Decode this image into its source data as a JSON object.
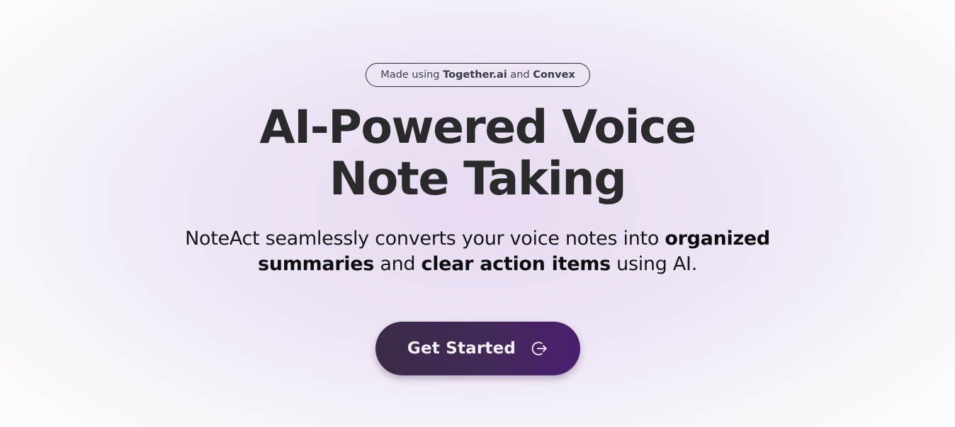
{
  "badge": {
    "prefix": "Made using",
    "brand1": "Together.ai",
    "conj": "and",
    "brand2": "Convex"
  },
  "hero": {
    "title_line1": "AI-Powered Voice",
    "title_line2": "Note Taking",
    "subtitle": {
      "part1": "NoteAct seamlessly converts your voice notes into ",
      "bold1": "organized summaries",
      "part2": " and ",
      "bold2": "clear action items",
      "part3": " using AI."
    }
  },
  "cta": {
    "label": "Get Started",
    "icon": "log-in-icon"
  },
  "colors": {
    "cta_start": "#3a2b47",
    "cta_end": "#4b1d70",
    "title": "#2a2a2c",
    "background": "#ede5f4"
  }
}
